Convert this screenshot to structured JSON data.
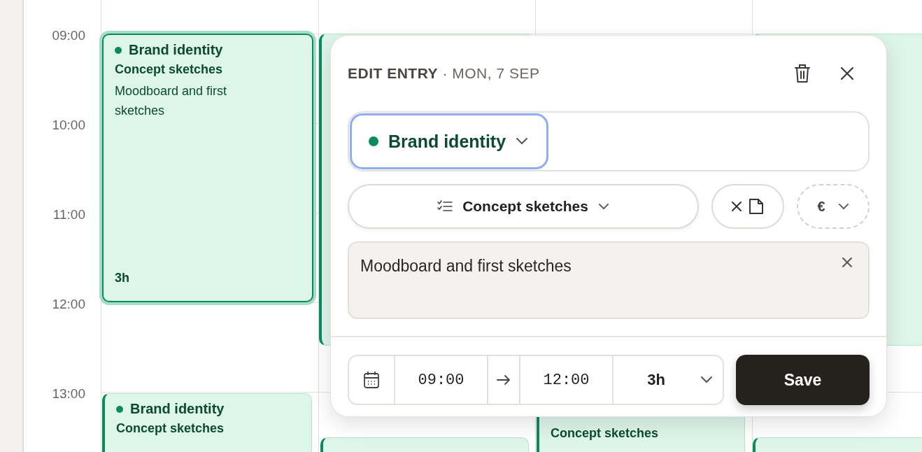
{
  "calendar": {
    "hours": [
      "09:00",
      "10:00",
      "11:00",
      "12:00",
      "13:00"
    ],
    "events": [
      {
        "title": "Brand identity",
        "subtitle": "Concept sketches",
        "description": "Moodboard and first sketches",
        "duration": "3h",
        "selected": true
      },
      {
        "title": "Brand identity",
        "subtitle": "Concept sketches",
        "selected": false
      },
      {
        "selected": false
      },
      {
        "selected": false
      },
      {
        "subtitle": "Concept sketches",
        "selected": false
      },
      {
        "selected": false
      },
      {
        "selected": false
      }
    ]
  },
  "editor": {
    "heading": "EDIT ENTRY",
    "date": "· MON, 7 SEP",
    "project": {
      "label": "Brand identity",
      "color": "#0a8a5f",
      "focused": true
    },
    "task": {
      "label": "Concept sketches"
    },
    "currency": {
      "symbol": "€"
    },
    "note": {
      "value": "Moodboard and first sketches"
    },
    "start": "09:00",
    "end": "12:00",
    "duration": "3h",
    "save": "Save"
  }
}
